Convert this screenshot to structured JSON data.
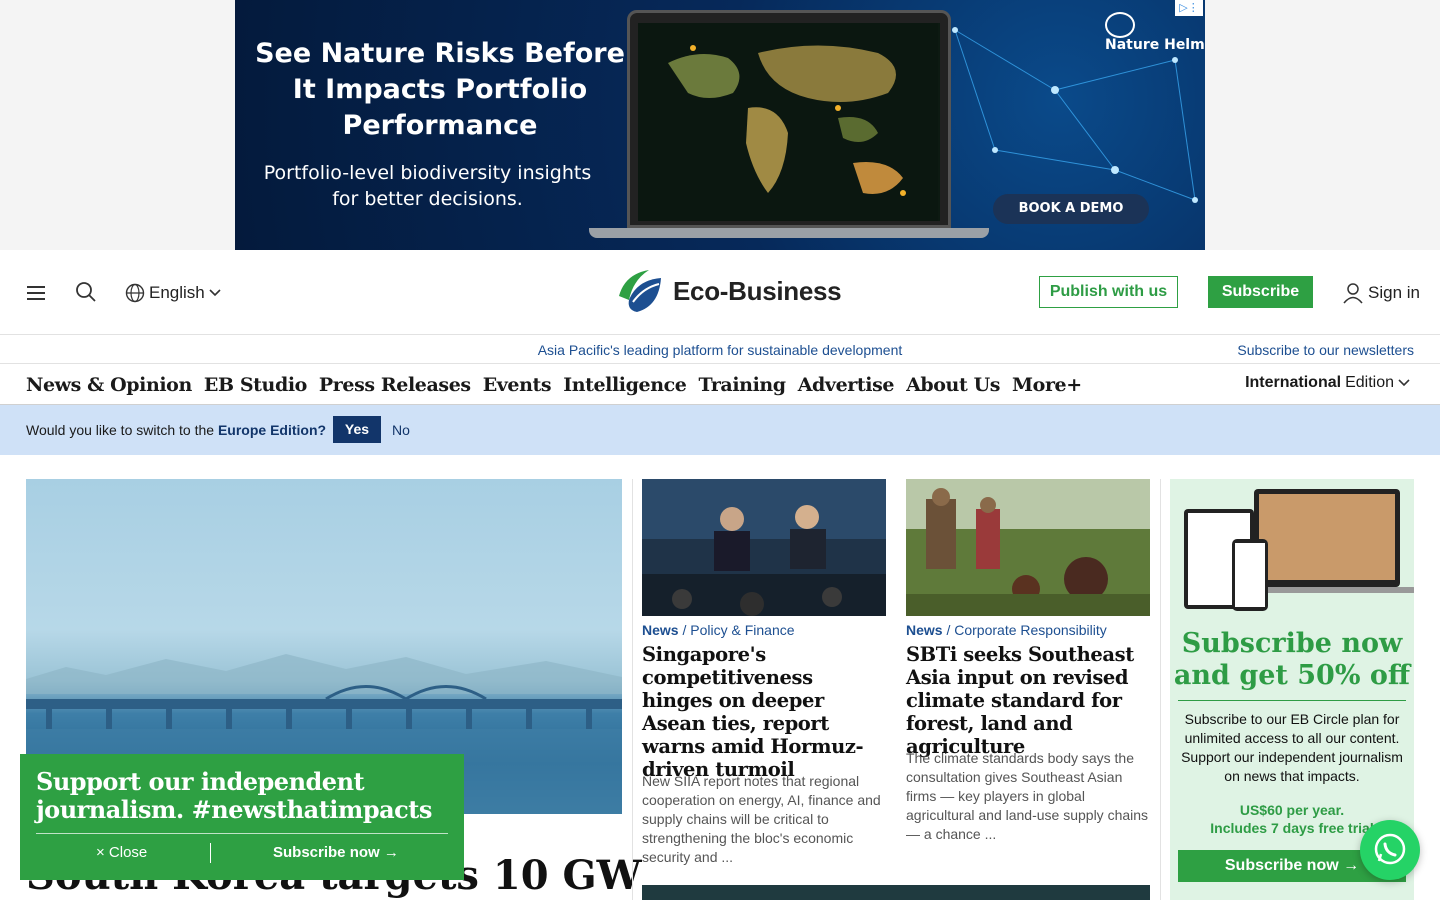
{
  "ad": {
    "headline": "See Nature Risks Before It Impacts Portfolio Performance",
    "subline": "Portfolio-level biodiversity insights for better decisions.",
    "cta": "BOOK A DEMO",
    "brand": "Nature Helm"
  },
  "header": {
    "language": "English",
    "logo_text": "Eco-Business",
    "publish_label": "Publish with us",
    "subscribe_label": "Subscribe",
    "signin_label": "Sign in",
    "tagline": "Asia Pacific's leading platform for sustainable development",
    "newsletter_link": "Subscribe to our newsletters"
  },
  "nav": {
    "items": [
      "News & Opinion",
      "EB Studio",
      "Press Releases",
      "Events",
      "Intelligence",
      "Training",
      "Advertise",
      "About Us",
      "More+"
    ],
    "edition_bold": "International",
    "edition_rest": "Edition"
  },
  "edition_prompt": {
    "question_pre": "Would you like to switch to the",
    "question_bold": "Europe Edition?",
    "yes": "Yes",
    "no": "No"
  },
  "hero": {
    "title": "South Korea targets 10 GW"
  },
  "cards": [
    {
      "cat_main": "News",
      "cat_sub": "Policy & Finance",
      "title": "Singapore's competitiveness hinges on deeper Asean ties, report warns amid Hormuz-driven turmoil",
      "body": "New SIIA report notes that regional cooperation on energy, AI, finance and supply chains will be critical to strengthening the bloc's economic security and ..."
    },
    {
      "cat_main": "News",
      "cat_sub": "Corporate Responsibility",
      "title": "SBTi seeks Southeast Asia input on revised climate standard for forest, land and agriculture",
      "body": "The climate standards body says the consultation gives Southeast Asian firms — key players in global agricultural and land-use supply chains — a chance ..."
    }
  ],
  "promo": {
    "title": "Subscribe now and get 50% off",
    "body": "Subscribe to our EB Circle plan for unlimited access to all our content. Support our independent journalism on news that impacts.",
    "price": "US$60 per year.",
    "trial": "Includes 7 days free trial",
    "cta": "Subscribe now →"
  },
  "support_banner": {
    "title": "Support our independent journalism. #newsthatimpacts",
    "close": "× Close",
    "subscribe": "Subscribe now →"
  },
  "colors": {
    "brand_green": "#2ea043",
    "link_blue": "#1d4f91",
    "edition_bar": "#cfe1f7",
    "navy": "#12356a"
  }
}
